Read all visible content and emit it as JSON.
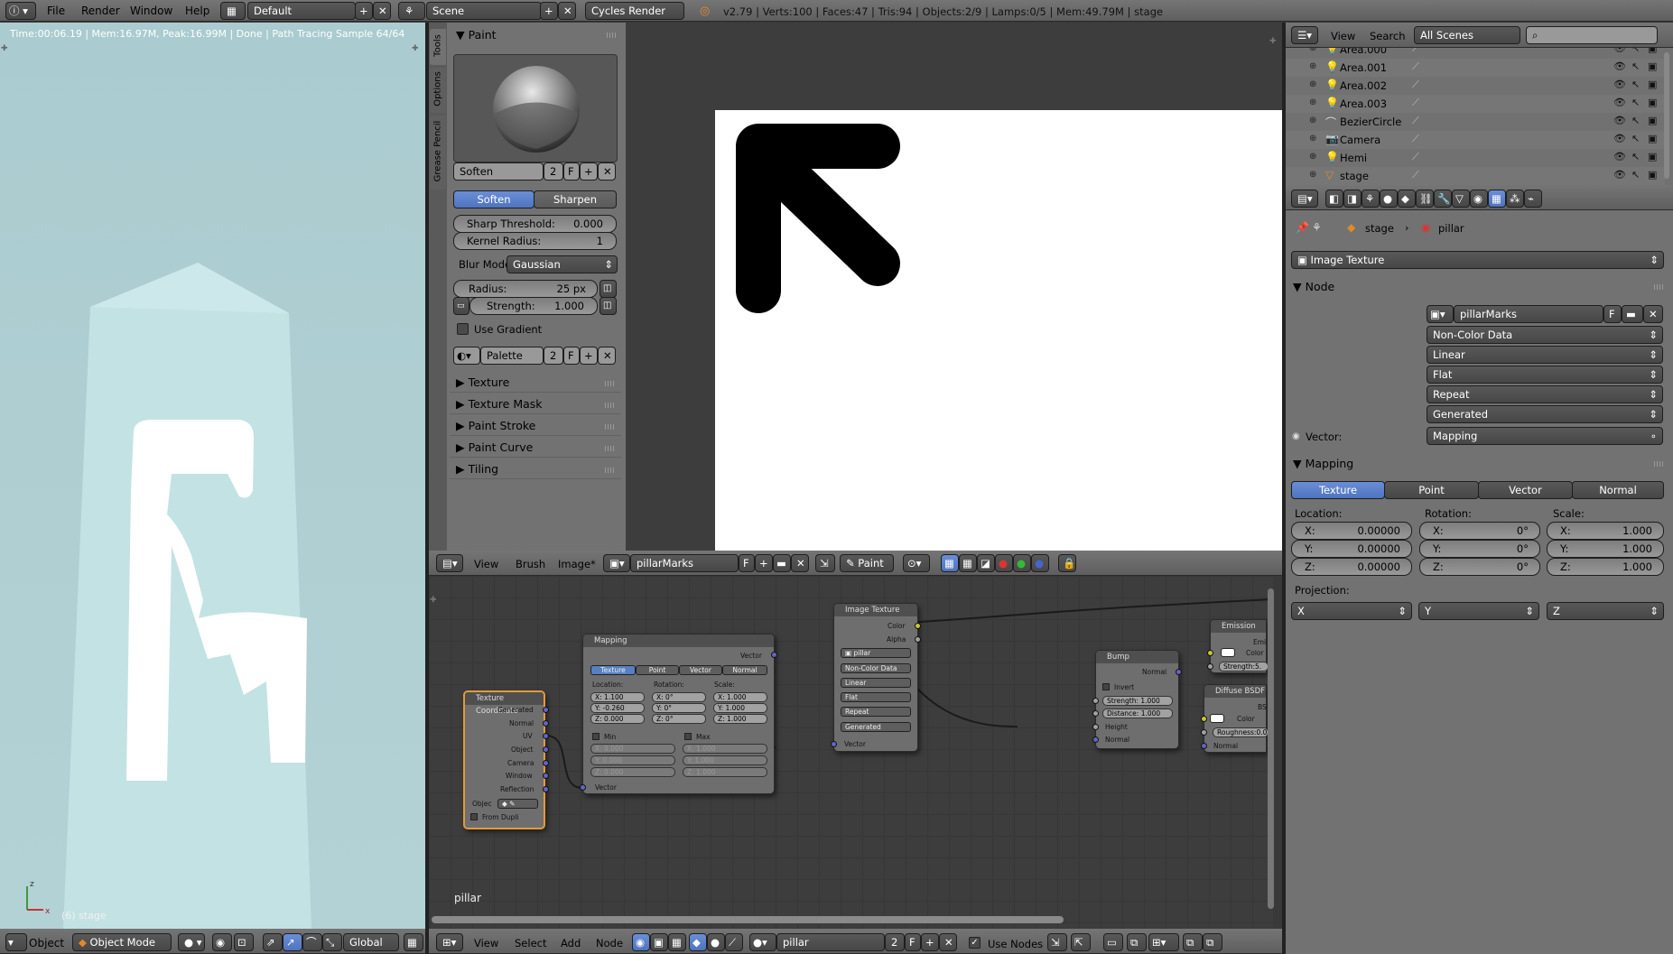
{
  "topbar": {
    "menus": [
      "File",
      "Render",
      "Window",
      "Help"
    ],
    "screen_layout": "Default",
    "scene": "Scene",
    "render_engine": "Cycles Render",
    "stats": "v2.79 | Verts:100 | Faces:47 | Tris:94 | Objects:2/9 | Lamps:0/5 | Mem:49.79M | stage"
  },
  "viewport": {
    "render_status": "Time:00:06.19 | Mem:16.97M, Peak:16.99M | Done | Path Tracing Sample 64/64",
    "object_label": "(6) stage",
    "header": {
      "menu": "Object",
      "mode": "Object Mode",
      "orientation": "Global"
    }
  },
  "tool_tabs": [
    "Tools",
    "Options",
    "Grease Pencil"
  ],
  "paint_panel": {
    "title": "Paint",
    "brush_name": "Soften",
    "brush_users": "2",
    "fake_user": "F",
    "modes": [
      "Soften",
      "Sharpen"
    ],
    "active_mode": "Soften",
    "sharp_threshold_label": "Sharp Threshold:",
    "sharp_threshold_value": "0.000",
    "kernel_radius_label": "Kernel Radius:",
    "kernel_radius_value": "1",
    "blur_mode_label": "Blur Mode:",
    "blur_mode_value": "Gaussian",
    "radius_label": "Radius:",
    "radius_value": "25 px",
    "strength_label": "Strength:",
    "strength_value": "1.000",
    "use_gradient": "Use Gradient",
    "palette_name": "Palette",
    "palette_users": "2",
    "collapsed_panels": [
      "Texture",
      "Texture Mask",
      "Paint Stroke",
      "Paint Curve",
      "Tiling"
    ]
  },
  "image_editor_header": {
    "menus": [
      "View",
      "Brush",
      "Image*"
    ],
    "image_name": "pillarMarks",
    "fake_user": "F",
    "mode": "Paint"
  },
  "node_editor": {
    "material_label": "pillar",
    "header": {
      "menus": [
        "View",
        "Select",
        "Add",
        "Node"
      ],
      "material": "pillar",
      "users": "2",
      "fake_user": "F",
      "use_nodes": "Use Nodes"
    },
    "texcoord": {
      "title": "Texture Coordinate",
      "outputs": [
        "Generated",
        "Normal",
        "UV",
        "Object",
        "Camera",
        "Window",
        "Reflection"
      ],
      "object_label": "Objec",
      "from_dupli": "From Dupli"
    },
    "mapping": {
      "title": "Mapping",
      "output": "Vector",
      "tabs": [
        "Texture",
        "Point",
        "Vector",
        "Normal"
      ],
      "location_label": "Location:",
      "rotation_label": "Rotation:",
      "scale_label": "Scale:",
      "location": [
        "X:   1.100",
        "Y:  -0.260",
        "Z:   0.000"
      ],
      "rotation": [
        "X:     0°",
        "Y:     0°",
        "Z:     0°"
      ],
      "scale": [
        "X:   1.000",
        "Y:   1.000",
        "Z:   1.000"
      ],
      "min_label": "Min",
      "max_label": "Max",
      "min": [
        "X:   0.000",
        "Y:   0.000",
        "Z:   0.000"
      ],
      "max": [
        "X:   1.000",
        "Y:   1.000",
        "Z:   1.000"
      ],
      "input": "Vector"
    },
    "image_texture": {
      "title": "Image Texture",
      "outputs": [
        "Color",
        "Alpha"
      ],
      "image": "pillar",
      "options": [
        "Non-Color Data",
        "Linear",
        "Flat",
        "Repeat",
        "Generated"
      ],
      "input": "Vector"
    },
    "bump": {
      "title": "Bump",
      "output": "Normal",
      "invert": "Invert",
      "strength": "Strength: 1.000",
      "distance": "Distance: 1.000",
      "inputs": [
        "Height",
        "Normal"
      ]
    },
    "emission": {
      "title": "Emission",
      "out": "Emi",
      "color": "Color",
      "strength": "Strength:5."
    },
    "diffuse": {
      "title": "Diffuse BSDF",
      "out": "BS",
      "color": "Color",
      "roughness": "Roughness:0.0",
      "normal": "Normal"
    }
  },
  "outliner": {
    "menus": [
      "View",
      "Search"
    ],
    "filter": "All Scenes",
    "items": [
      "Area.000",
      "Area.001",
      "Area.002",
      "Area.003",
      "BezierCircle",
      "Camera",
      "Hemi",
      "stage"
    ]
  },
  "properties": {
    "breadcrumb": [
      "stage",
      "pillar"
    ],
    "node_type": "Image Texture",
    "node_section": "Node",
    "image_name": "pillarMarks",
    "fake_user": "F",
    "options": [
      "Non-Color Data",
      "Linear",
      "Flat",
      "Repeat",
      "Generated"
    ],
    "vector_label": "Vector:",
    "vector_value": "Mapping",
    "mapping_section": "Mapping",
    "mapping_tabs": [
      "Texture",
      "Point",
      "Vector",
      "Normal"
    ],
    "location_label": "Location:",
    "rotation_label": "Rotation:",
    "scale_label": "Scale:",
    "location": [
      [
        "X:",
        "0.00000"
      ],
      [
        "Y:",
        "0.00000"
      ],
      [
        "Z:",
        "0.00000"
      ]
    ],
    "rotation": [
      [
        "X:",
        "0°"
      ],
      [
        "Y:",
        "0°"
      ],
      [
        "Z:",
        "0°"
      ]
    ],
    "scale": [
      [
        "X:",
        "1.000"
      ],
      [
        "Y:",
        "1.000"
      ],
      [
        "Z:",
        "1.000"
      ]
    ],
    "projection_label": "Projection:",
    "projection": [
      "X",
      "Y",
      "Z"
    ]
  },
  "colors": {
    "ui_bg": "#393939",
    "panel": "#727272",
    "selected": "#5680c2",
    "viewport": "#adcfd3",
    "node_grid": "#3d3d3d"
  }
}
